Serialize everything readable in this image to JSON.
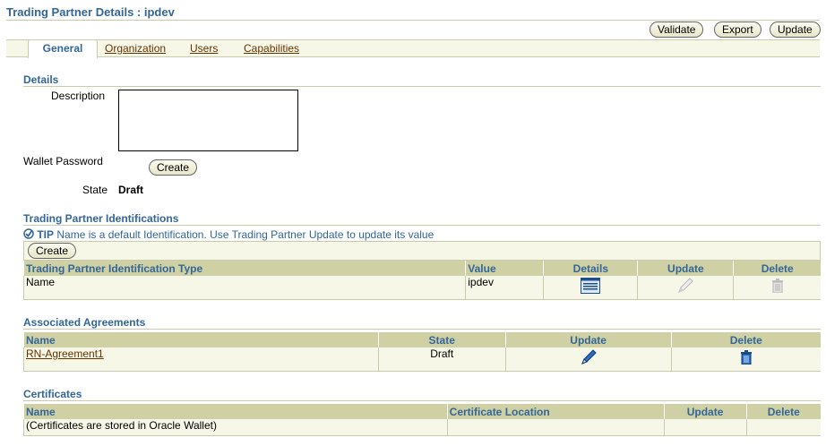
{
  "page": {
    "title": "Trading Partner Details : ipdev"
  },
  "toolbar": {
    "validate": "Validate",
    "export": "Export",
    "update": "Update"
  },
  "tabs": {
    "general": "General",
    "organization": "Organization",
    "users": "Users",
    "capabilities": "Capabilities"
  },
  "details": {
    "heading": "Details",
    "description_label": "Description",
    "description_value": "",
    "wallet_label": "Wallet Password",
    "wallet_create": "Create",
    "state_label": "State",
    "state_value": "Draft"
  },
  "identifications": {
    "heading": "Trading Partner Identifications",
    "tip_label": "TIP",
    "tip_text": "Name is a default Identification. Use Trading Partner Update to update its value",
    "create": "Create",
    "columns": {
      "type": "Trading Partner Identification Type",
      "value": "Value",
      "details": "Details",
      "update": "Update",
      "delete": "Delete"
    },
    "rows": [
      {
        "type": "Name",
        "value": "ipdev"
      }
    ]
  },
  "agreements": {
    "heading": "Associated Agreements",
    "columns": {
      "name": "Name",
      "state": "State",
      "update": "Update",
      "delete": "Delete"
    },
    "rows": [
      {
        "name": "RN-Agreement1",
        "state": "Draft"
      }
    ]
  },
  "certificates": {
    "heading": "Certificates",
    "columns": {
      "name": "Name",
      "location": "Certificate Location",
      "update": "Update",
      "delete": "Delete"
    },
    "rows": [
      {
        "name": "(Certificates are stored in Oracle Wallet)",
        "location": ""
      }
    ]
  },
  "colors": {
    "heading": "#336699",
    "link": "#663300",
    "table_header": "#cfd0a3",
    "table_cell": "#f7f7e7"
  }
}
